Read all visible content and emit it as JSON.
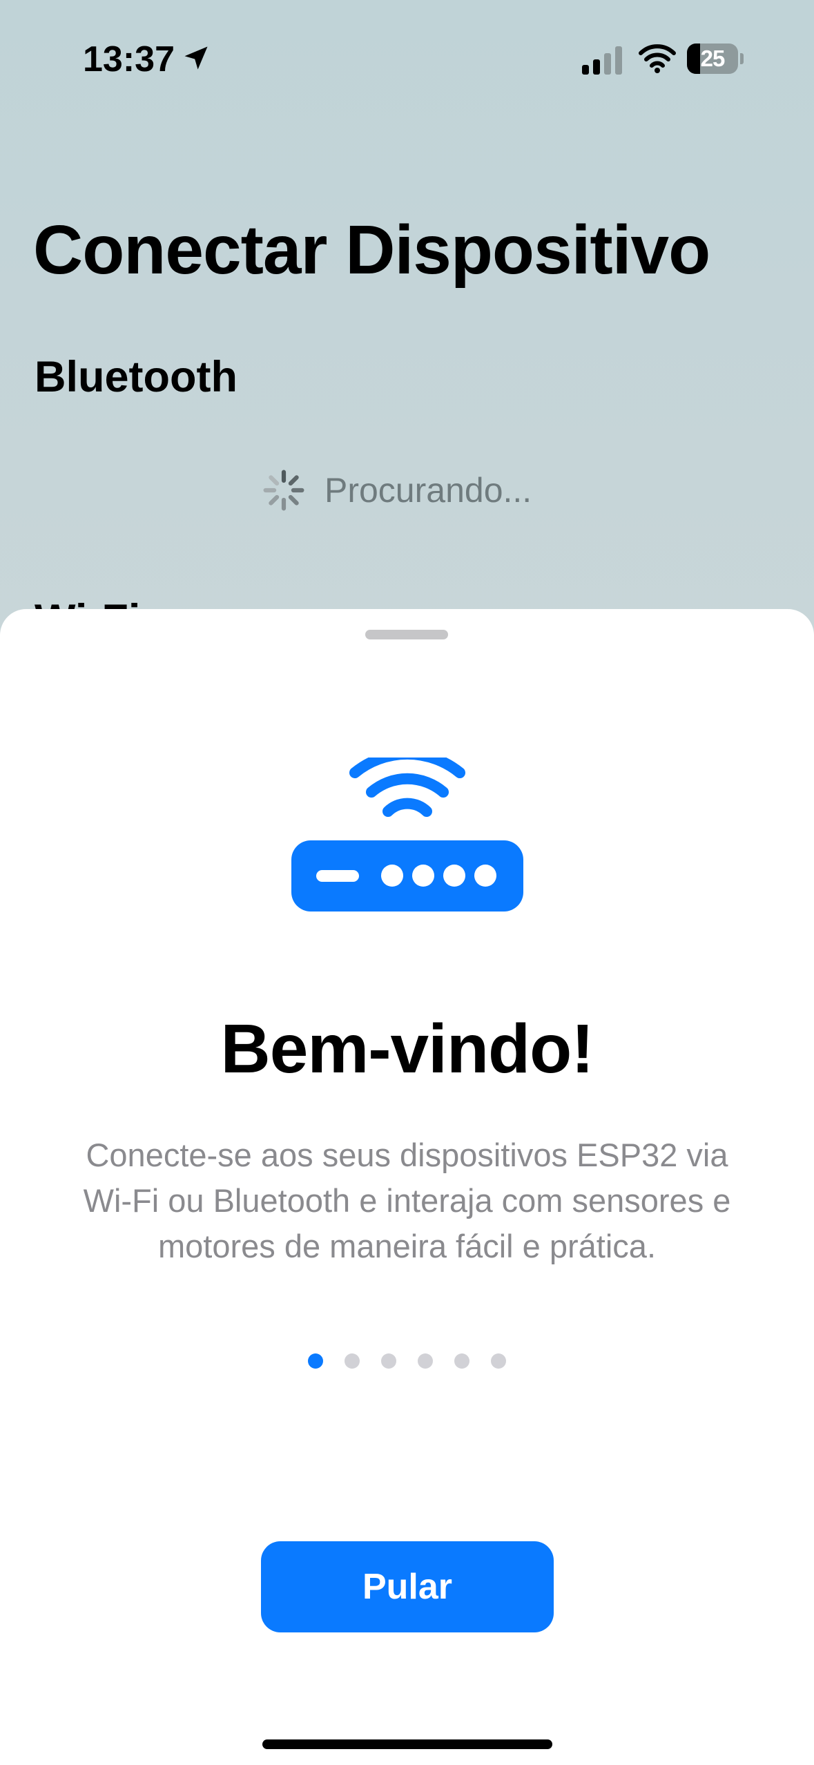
{
  "status_bar": {
    "time": "13:37",
    "battery_level": "25",
    "icons": [
      "location-arrow-icon",
      "cellular-signal-icon",
      "wifi-signal-icon",
      "battery-icon"
    ]
  },
  "screen": {
    "title": "Conectar Dispositivo",
    "bluetooth_section": "Bluetooth",
    "searching_label": "Procurando...",
    "wifi_section": "Wi-Fi"
  },
  "onboarding": {
    "icon": "wifi-router-icon",
    "title": "Bem-vindo!",
    "description": "Conecte-se aos seus dispositivos ESP32 via Wi-Fi ou Bluetooth e interaja com sensores e motores de maneira fácil e prática.",
    "page_count": 6,
    "current_page": 1,
    "skip_label": "Pular"
  },
  "colors": {
    "accent": "#0a7aff",
    "background": "#c0d3d7",
    "sheet": "#ffffff",
    "secondary_text": "#8a8a8e"
  }
}
